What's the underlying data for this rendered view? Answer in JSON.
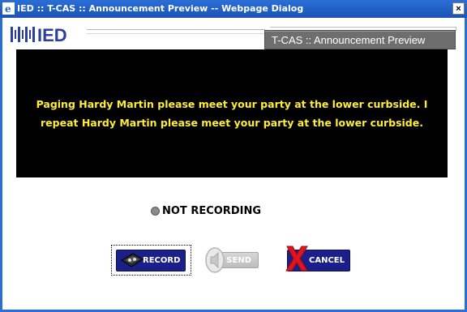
{
  "window": {
    "title": "IED :: T-CAS :: Announcement Preview -- Webpage Dialog",
    "close_label": "×"
  },
  "header": {
    "logo_text": "IED",
    "page_title": "T-CAS :: Announcement Preview"
  },
  "preview": {
    "message": "Paging Hardy Martin please meet your party at the lower curbside. I repeat Hardy Martin please meet your party at the lower curbside."
  },
  "status": {
    "recording_text": "NOT RECORDING"
  },
  "buttons": {
    "record_label": "RECORD",
    "send_label": "SEND",
    "cancel_label": "CANCEL"
  },
  "colors": {
    "titlebar": "#2a6fd6",
    "preview_bg": "#000000",
    "preview_text": "#ffee33",
    "button_blue": "#1b1f8a",
    "cancel_x": "#e0141e"
  },
  "icons": {
    "titlebar": "ie-icon",
    "close": "close-icon",
    "status": "status-dot-icon",
    "record": "tape-icon",
    "send": "speaker-icon",
    "cancel": "x-icon"
  }
}
